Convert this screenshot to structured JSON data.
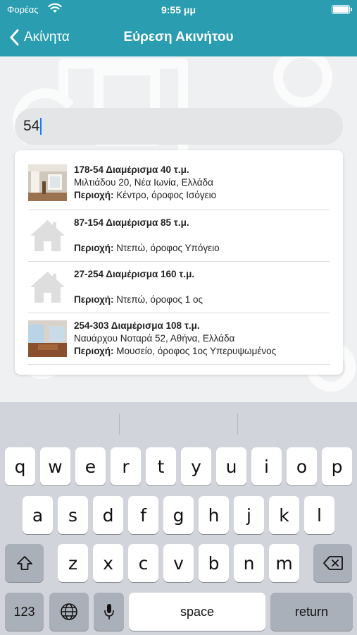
{
  "status_bar": {
    "carrier": "Φορέας",
    "time": "9:55 μμ"
  },
  "nav": {
    "back_label": "Ακίνητα",
    "title": "Εύρεση Ακινήτου"
  },
  "search": {
    "value": "54"
  },
  "results": [
    {
      "title": "178-54 Διαμέρισμα 40 τ.μ.",
      "address": "Μιλτιάδου 20, Νέα Ιωνία, Ελλάδα",
      "area_label": "Περιοχή:",
      "area_value": "Κέντρο, όροφος Ισόγειο",
      "image": "apartment-photo"
    },
    {
      "title": "87-154 Διαμέρισμα 85 τ.μ.",
      "address": "",
      "area_label": "Περιοχή:",
      "area_value": "Ντεπώ, όροφος Υπόγειο",
      "image": "house-icon"
    },
    {
      "title": "27-254 Διαμέρισμα 160 τ.μ.",
      "address": "",
      "area_label": "Περιοχή:",
      "area_value": "Ντεπώ, όροφος 1 ος",
      "image": "house-icon"
    },
    {
      "title": "254-303 Διαμέρισμα 108 τ.μ.",
      "address": "Ναυάρχου Νοταρά 52, Αθήνα, Ελλάδα",
      "area_label": "Περιοχή:",
      "area_value": "Μουσείο, όροφος 1ος Υπερυψωμένος",
      "image": "apartment-photo"
    }
  ],
  "keyboard": {
    "row1": [
      "q",
      "w",
      "e",
      "r",
      "t",
      "y",
      "u",
      "i",
      "o",
      "p"
    ],
    "row2": [
      "a",
      "s",
      "d",
      "f",
      "g",
      "h",
      "j",
      "k",
      "l"
    ],
    "row3": [
      "z",
      "x",
      "c",
      "v",
      "b",
      "n",
      "m"
    ],
    "numbers_label": "123",
    "space_label": "space",
    "return_label": "return"
  },
  "colors": {
    "header": "#2a9db1",
    "caret": "#1b7cf0",
    "keyboard_bg": "#d1d4da"
  }
}
